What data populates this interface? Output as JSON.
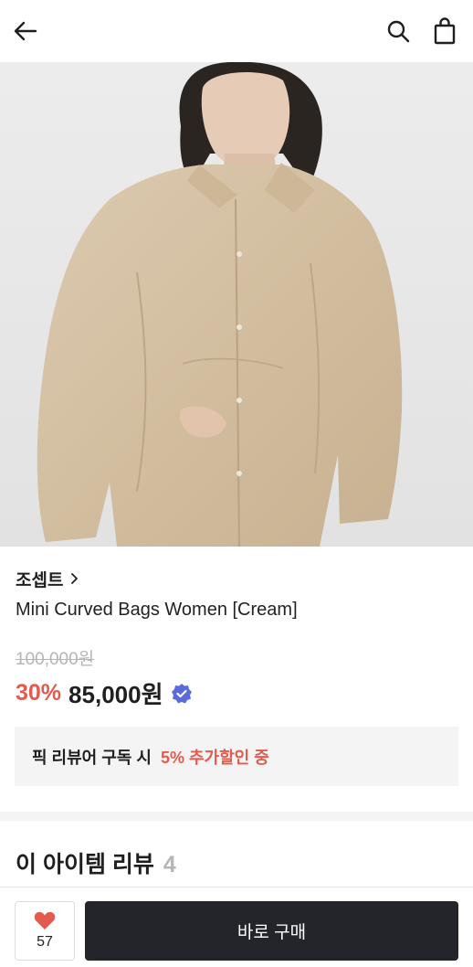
{
  "header": {
    "back_icon": "arrow-left-icon",
    "search_icon": "search-icon",
    "bag_icon": "shopping-bag-icon"
  },
  "product": {
    "image_subject": "model in oversized beige linen shirt",
    "brand": "조셉트",
    "brand_chevron_icon": "chevron-right-icon",
    "name": "Mini Curved Bags Women [Cream]",
    "original_price": "100,000원",
    "discount": "30%",
    "sale_price": "85,000원",
    "verified_icon": "verified-check-icon"
  },
  "promo": {
    "text": "픽 리뷰어 구독 시",
    "highlight": "5% 추가할인 중"
  },
  "reviews": {
    "title": "이 아이템 리뷰",
    "count": "4"
  },
  "bottom_bar": {
    "like_icon": "heart-icon",
    "like_count": "57",
    "buy_label": "바로 구매"
  },
  "colors": {
    "accent_red": "#e35a4e",
    "verified_blue": "#5b6bdc",
    "buy_button": "#23252b",
    "strikethrough_grey": "#b5b5b5"
  }
}
